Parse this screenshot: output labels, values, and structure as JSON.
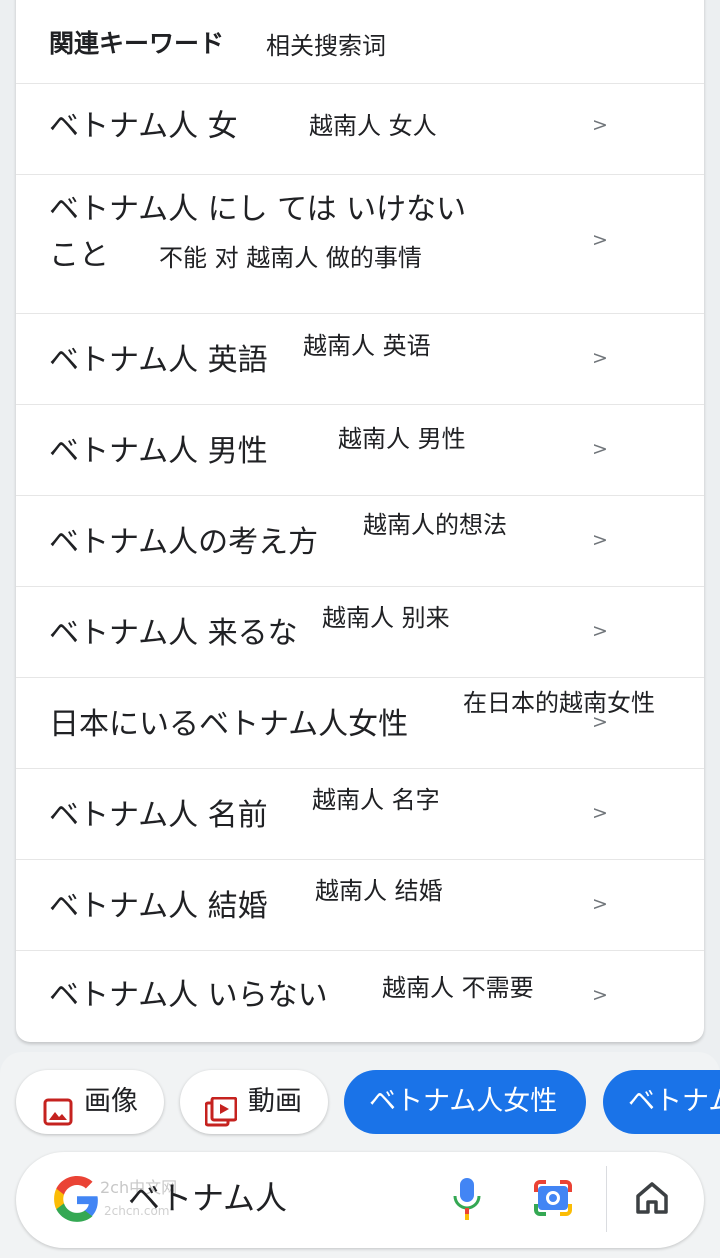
{
  "related": {
    "title": "関連キーワード",
    "title_note": "相关搜索词",
    "chevron": ">",
    "items": [
      {
        "text": "ベトナム人 女",
        "note": "越南人 女人"
      },
      {
        "text": "ベトナム人 にし ては いけない",
        "text2": "こと",
        "note": "不能 对 越南人 做的事情"
      },
      {
        "text": "ベトナム人 英語",
        "note": "越南人 英语"
      },
      {
        "text": "ベトナム人 男性",
        "note": "越南人 男性"
      },
      {
        "text": "ベトナム人の考え方",
        "note": "越南人的想法"
      },
      {
        "text": "ベトナム人 来るな",
        "note": "越南人 别来"
      },
      {
        "text": "日本にいるベトナム人女性",
        "note": "在日本的越南女性"
      },
      {
        "text": "ベトナム人 名前",
        "note": "越南人 名字"
      },
      {
        "text": "ベトナム人 結婚",
        "note": "越南人 结婚"
      },
      {
        "text": "ベトナム人 いらない",
        "note": "越南人 不需要"
      }
    ]
  },
  "chips": {
    "images": "画像",
    "videos": "動画",
    "suggestion1": "ベトナム人女性",
    "suggestion2": "ベトナム"
  },
  "search": {
    "query": "ベトナム人",
    "watermark": "2ch中文网",
    "watermark_sub": "2chcn.com"
  },
  "colors": {
    "accent": "#1a73e8",
    "chip_icon": "#c5221f"
  },
  "icons": [
    "image-icon",
    "video-icon",
    "google-logo-icon",
    "mic-icon",
    "lens-icon",
    "home-icon"
  ]
}
